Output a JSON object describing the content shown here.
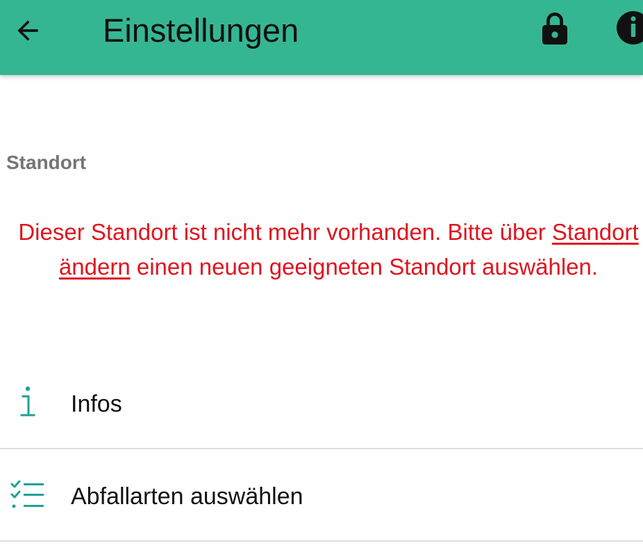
{
  "appbar": {
    "title": "Einstellungen",
    "back_icon": "arrow-left-icon",
    "lock_icon": "lock-icon",
    "info_icon": "info-circle-icon",
    "color": "#35b692"
  },
  "section": {
    "title": "Standort"
  },
  "warning": {
    "text_before": "Dieser Standort ist nicht mehr vorhanden. Bitte über ",
    "link_text": "Standort ändern",
    "text_after": " einen neuen geeigneten Standort auswählen.",
    "color": "#e0141e"
  },
  "items": [
    {
      "label": "Infos",
      "icon": "info-letter-icon"
    },
    {
      "label": "Abfallarten auswählen",
      "icon": "checklist-icon"
    }
  ],
  "accent_color": "#1ea296"
}
